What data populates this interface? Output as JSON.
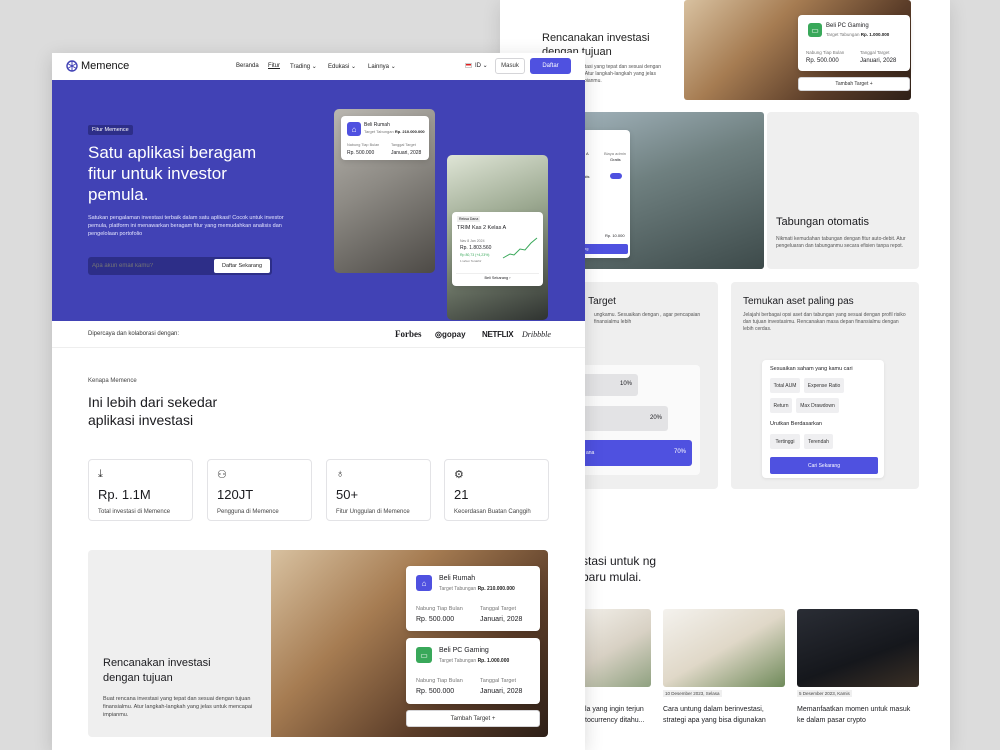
{
  "back": {
    "plan_card_title": "Rencanakan investasi dengan tujuan",
    "plan_card_desc": "Buat rencana investasi yang tepat dan sesuai dengan tujuan finansialmu. Atur langkah-langkah yang jelas untuk mencapai impianmu.",
    "goal2": {
      "title": "Beli PC Gaming",
      "target_label": "Target Tabungan",
      "target_value": "Rp. 1.000.000",
      "monthly_value": "Rp. 500.000",
      "monthly_label": "Nabung Tiap Bulan",
      "date_label": "Tanggal Target",
      "date_value": "Januari, 2028"
    },
    "add_target": "Tambah Target",
    "auto_title": "Tabungan otomatis",
    "auto_desc": "Nikmati kemudahan tabungan dengan fitur auto-debit. Atur pengeluaran dan tabunganmu secara efisien tanpa repot.",
    "target_title": "n Target",
    "target_desc": "ungkamu. Sesuaikan dengan , agar pencapaian finansialmu lebih",
    "bar_values": [
      "10%",
      "20%",
      "70%"
    ],
    "bar_label_last": "ana",
    "assets_title": "Temukan aset paling pas",
    "assets_desc": "Jelajahi berbagai opsi aset dan tabungan yang sesuai dengan profil risiko dan tujuan investasimu. Rencanakan masa depan finansialmu dengan lebih cerdas.",
    "filter_title": "Sesuaikan saham yang kamu cari",
    "filter_chips": [
      "Total AUM",
      "Expense Ratio",
      "Return",
      "Max Drawdown"
    ],
    "sort_title": "Urutkan Berdasarkan",
    "sort_chips": [
      "Tertinggi",
      "Terendah"
    ],
    "search_btn": "Cari Sekarang",
    "blog_heading": "stasi untuk ng baru mulai.",
    "articles": [
      {
        "date": "",
        "title": "la yang ingin terjun tocurrency ditahu..."
      },
      {
        "date": "10 Desember 2023, Selasa",
        "title": "Cara untung dalam berinvestasi, strategi apa yang bisa digunakan"
      },
      {
        "date": "5 Desember 2023, Kamis",
        "title": "Memanfaatkan momen untuk masuk ke dalam pasar crypto"
      }
    ],
    "auto_widget": {
      "row1_a": "A",
      "row1_b": "Biaya admin",
      "row1_c": "Gratis",
      "toggle_label": "ratis",
      "amount": "Rp. 10.000",
      "cta": "ng"
    }
  },
  "front": {
    "brand": "Memence",
    "nav": [
      "Beranda",
      "Fitur",
      "Trading",
      "Edukasi",
      "Lainnya"
    ],
    "lang": "ID",
    "login": "Masuk",
    "signup": "Daftar",
    "hero_badge": "Fitur Memence",
    "hero_title": "Satu aplikasi beragam fitur untuk investor pemula.",
    "hero_desc": "Satukan pengalaman investasi terbaik dalam satu aplikasi! Cocok untuk investor pemula, platform ini menawarkan beragam fitur yang memudahkan analisis dan pengelolaan portofolio",
    "email_placeholder": "Apa akun email kamu?",
    "cta": "Daftar Sekarang",
    "hero_goal": {
      "title": "Beli Rumah",
      "target_label": "Target Tabungan",
      "target_value": "Rp. 210.000.000",
      "monthly_label": "Nabung Tiap Bulan",
      "monthly_value": "Rp. 500.000",
      "date_label": "Tanggal Target",
      "date_value": "Januari, 2028"
    },
    "trim": {
      "tag": "Reksa Dana",
      "title": "TRIM Kas 2 Kelas A",
      "date": "Nav 8 Jan 2024",
      "price": "Rp. 1.803.560",
      "change": "Rp 80,73 (+4,23%)",
      "period": "1 tahun Terakhir",
      "buy": "Beli Sekarang"
    },
    "trust_label": "Dipercaya dan kolaborasi dengan:",
    "partners": [
      "Forbes",
      "gopay",
      "NETFLIX",
      "Dribbble"
    ],
    "why_label": "Kenapa Memence",
    "why_title": "Ini lebih dari sekedar aplikasi investasi",
    "stats": [
      {
        "icon": "download-icon",
        "num": "Rp. 1.1M",
        "label": "Total investasi di Memence"
      },
      {
        "icon": "users-icon",
        "num": "120JT",
        "label": "Pengguna di Memence"
      },
      {
        "icon": "lightbulb-icon",
        "num": "50+",
        "label": "Fitur Unggulan di Memence"
      },
      {
        "icon": "chip-icon",
        "num": "21",
        "label": "Kecerdasan Buatan Canggih"
      }
    ],
    "plan_title": "Rencanakan investasi dengan tujuan",
    "plan_desc": "Buat rencana investasi yang tepat dan sesuai dengan tujuan finansialmu. Atur langkah-langkah yang jelas untuk mencapai impianmu.",
    "goals": [
      {
        "title": "Beli Rumah",
        "target_label": "Target Tabungan",
        "target_value": "Rp. 210.000.000",
        "monthly_label": "Nabung Tiap Bulan",
        "monthly_value": "Rp. 500.000",
        "date_label": "Tanggal Target",
        "date_value": "Januari, 2028"
      },
      {
        "title": "Beli PC Gaming",
        "target_label": "Target Tabungan",
        "target_value": "Rp. 1.000.000",
        "monthly_label": "Nabung Tiap Bulan",
        "monthly_value": "Rp. 500.000",
        "date_label": "Tanggal Target",
        "date_value": "Januari, 2028"
      }
    ],
    "add_target": "Tambah Target"
  },
  "colors": {
    "primary": "#4142b5",
    "accent": "#4f51e0",
    "green": "#39a85a"
  }
}
